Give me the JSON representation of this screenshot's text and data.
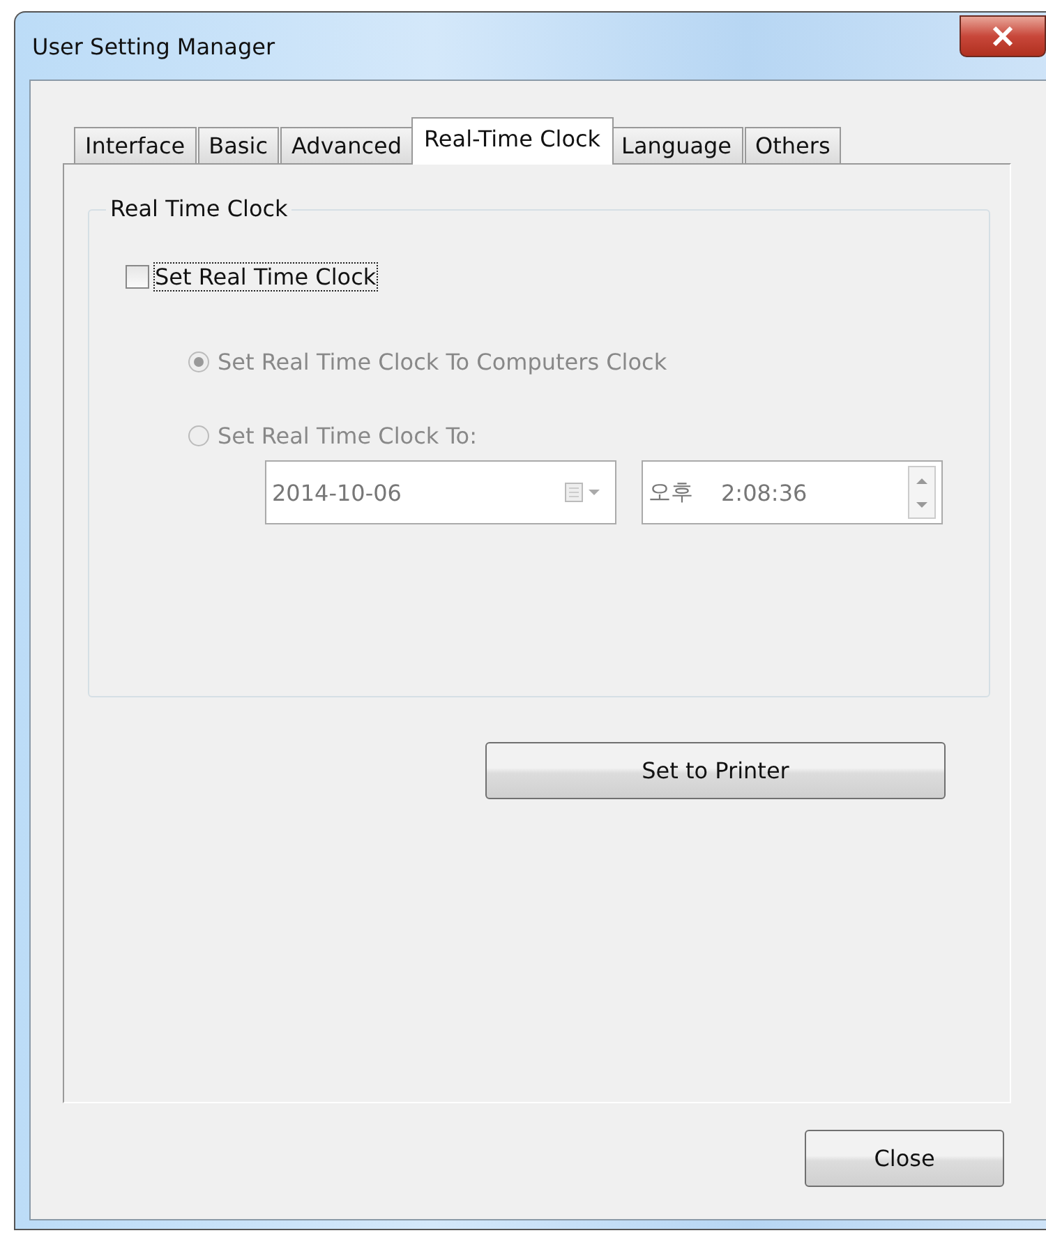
{
  "window": {
    "title": "User Setting Manager"
  },
  "tabs": [
    {
      "label": "Interface",
      "selected": false
    },
    {
      "label": "Basic",
      "selected": false
    },
    {
      "label": "Advanced",
      "selected": false
    },
    {
      "label": "Real-Time Clock",
      "selected": true
    },
    {
      "label": "Language",
      "selected": false
    },
    {
      "label": "Others",
      "selected": false
    }
  ],
  "group": {
    "title": "Real Time Clock"
  },
  "checkbox": {
    "label": "Set Real Time Clock",
    "checked": false,
    "focused": true
  },
  "radios": [
    {
      "label": "Set Real Time Clock To Computers Clock",
      "selected": true,
      "disabled": true
    },
    {
      "label": "Set Real Time Clock To:",
      "selected": false,
      "disabled": true
    }
  ],
  "date_field": {
    "value": "2014-10-06",
    "disabled": true
  },
  "time_field": {
    "period": "오후",
    "value": "2:08:36",
    "disabled": true
  },
  "set_button": {
    "label": "Set to Printer"
  },
  "close_button": {
    "label": "Close"
  }
}
